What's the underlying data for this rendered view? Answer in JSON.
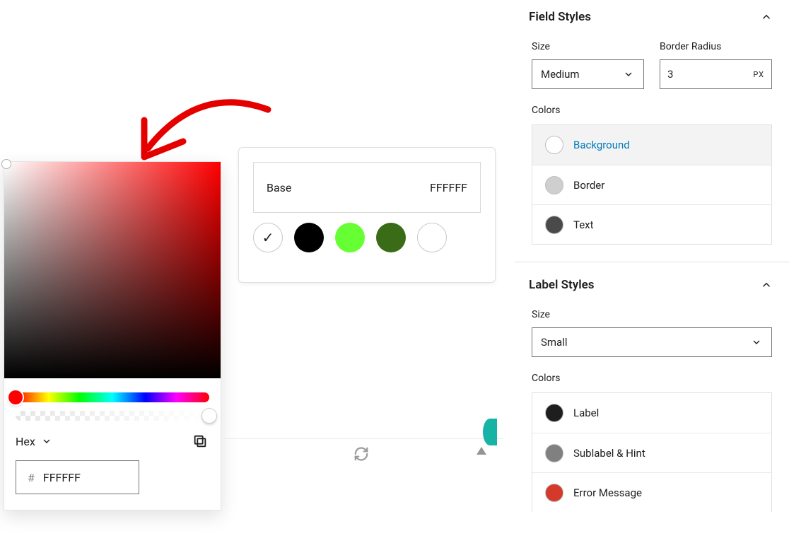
{
  "annotation": {
    "color": "#e50000"
  },
  "base_card": {
    "label": "Base",
    "value": "FFFFFF",
    "swatches": [
      {
        "name": "none",
        "bg": "#ffffff",
        "outline": true,
        "checked": true
      },
      {
        "name": "black",
        "bg": "#000000",
        "outline": false,
        "checked": false
      },
      {
        "name": "lime",
        "bg": "#66ff33",
        "outline": false,
        "checked": false
      },
      {
        "name": "darkgreen",
        "bg": "#3a6b17",
        "outline": false,
        "checked": false
      },
      {
        "name": "white",
        "bg": "#ffffff",
        "outline": true,
        "checked": false
      }
    ]
  },
  "picker": {
    "format_label": "Hex",
    "hex_prefix": "#",
    "hex_value": "FFFFFF"
  },
  "panel": {
    "field_styles": {
      "title": "Field Styles",
      "size_label": "Size",
      "size_value": "Medium",
      "radius_label": "Border Radius",
      "radius_value": "3",
      "radius_unit": "PX",
      "colors_label": "Colors",
      "colors": [
        {
          "name": "background",
          "label": "Background",
          "swatch": "#ffffff",
          "active": true
        },
        {
          "name": "border",
          "label": "Border",
          "swatch": "#cfcfcf",
          "active": false
        },
        {
          "name": "text",
          "label": "Text",
          "swatch": "#4a4a4a",
          "active": false
        }
      ]
    },
    "label_styles": {
      "title": "Label Styles",
      "size_label": "Size",
      "size_value": "Small",
      "colors_label": "Colors",
      "colors": [
        {
          "name": "label",
          "label": "Label",
          "swatch": "#1e1e1e"
        },
        {
          "name": "sublabel",
          "label": "Sublabel & Hint",
          "swatch": "#808080"
        },
        {
          "name": "error",
          "label": "Error Message",
          "swatch": "#d33a2c"
        }
      ]
    }
  }
}
